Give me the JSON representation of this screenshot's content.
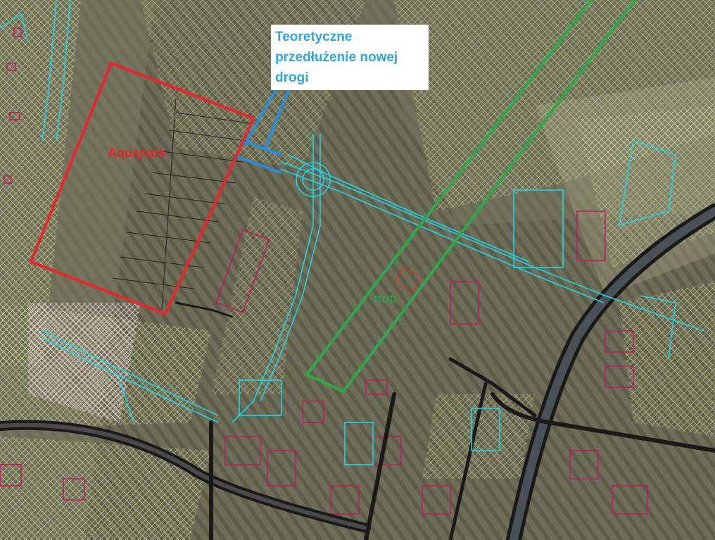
{
  "map": {
    "callout": {
      "lines": [
        "Teoretyczne",
        "przedłużenie nowej",
        "drogi"
      ]
    },
    "labels": {
      "aquapark": "Aquapark",
      "rod": "ROD"
    },
    "colors": {
      "aquapark_outline": "#e8262b",
      "rod_outline": "#2ea84a",
      "new_road_extension": "#1e90e6",
      "utility_lines": "#1fd4e8",
      "buildings": "#c2185b",
      "roads": "#1a1a1a",
      "parcel_hatch": "#dfe8a8",
      "callout_text": "#2fa6dc"
    }
  }
}
